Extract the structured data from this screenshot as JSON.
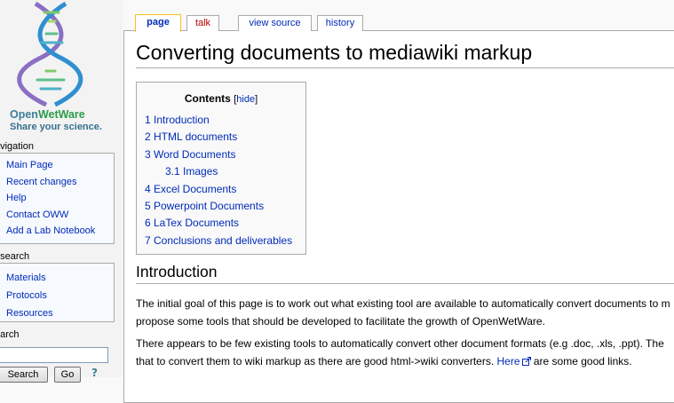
{
  "logo": {
    "line1_a": "Open",
    "line1_b": "WetWare",
    "line2": "Share your science."
  },
  "sidebar": {
    "navigation_heading": "avigation",
    "navigation_items": [
      "Main Page",
      "Recent changes",
      "Help",
      "Contact OWW",
      "Add a Lab Notebook"
    ],
    "research_heading": "esearch",
    "research_items": [
      "Materials",
      "Protocols",
      "Resources"
    ],
    "search_heading": "earch",
    "search_button": "Search",
    "go_button": "Go",
    "help_glyph": "?"
  },
  "tabs": {
    "page": "page",
    "talk": "talk",
    "view_source": "view source",
    "history": "history"
  },
  "page": {
    "title": "Converting documents to mediawiki markup",
    "toc": {
      "title": "Contents",
      "hide_open": "[",
      "hide_label": "hide",
      "hide_close": "]",
      "items": [
        "1 Introduction",
        "2 HTML documents",
        "3 Word Documents",
        "3.1 Images",
        "4 Excel Documents",
        "5 Powerpoint Documents",
        "6 LaTex Documents",
        "7 Conclusions and deliverables"
      ]
    },
    "section_heading": "Introduction",
    "para1_line1": "The initial goal of this page is to work out what existing tool are available to automatically convert documents to m",
    "para1_line2": "propose some tools that should be developed to facilitate the growth of OpenWetWare.",
    "para2_line1": "There appears to be few existing tools to automatically convert other document formats (e.g .doc, .xls, .ppt). The",
    "para2_line2_before": "that to convert them to wiki markup as there are good html->wiki converters. ",
    "para2_link": "Here",
    "para2_line2_after": " are some good links."
  },
  "colors": {
    "link": "#002bb8",
    "new_link": "#ba0000",
    "selected_tab": "#fabd23",
    "logo_blue": "#3d7e9a",
    "logo_green": "#2d9b4a"
  },
  "icons": [
    "dna-helix-logo",
    "external-link-icon"
  ]
}
